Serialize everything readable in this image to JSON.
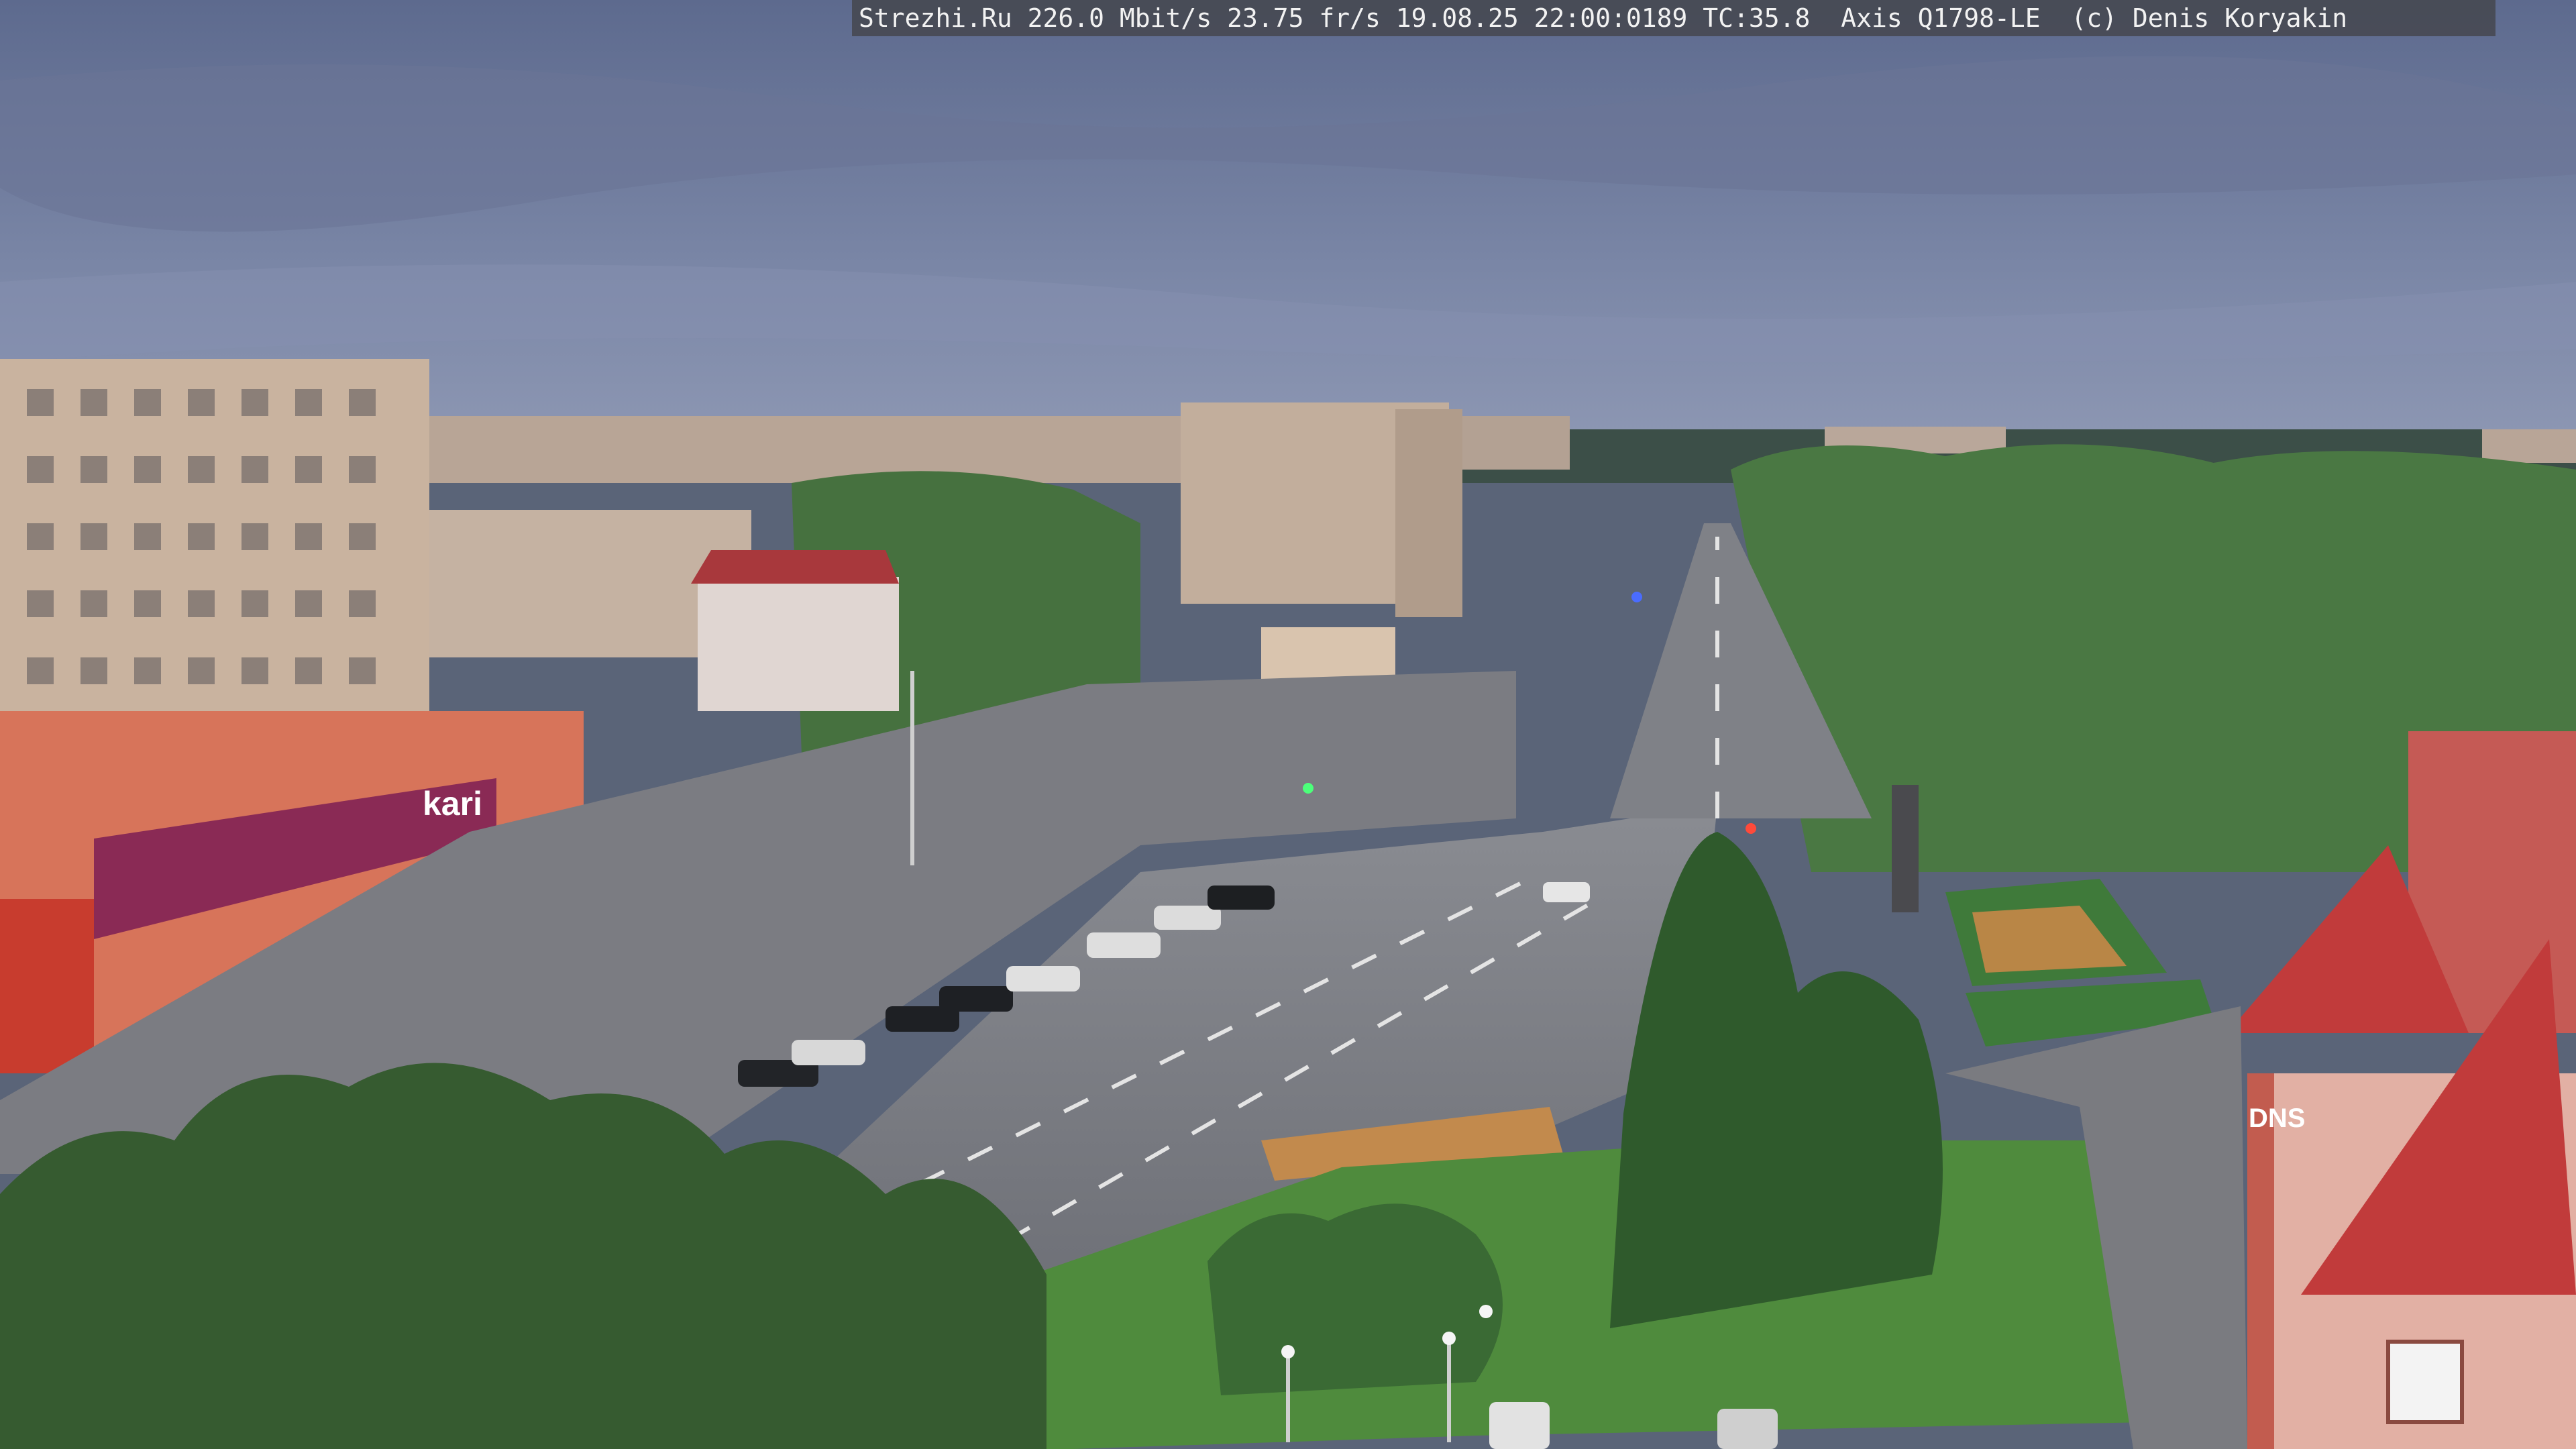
{
  "overlay": {
    "text": "Strezhi.Ru 226.0 Mbit/s 23.75 fr/s 19.08.25 22:00:0189 TC:35.8  Axis Q1798-LE  (c) Denis Koryakin"
  },
  "signs": {
    "kari_store": "kari",
    "dns_store": "DNS"
  },
  "colors": {
    "sky": "#6f7ca0",
    "trees": "#3f6b3a",
    "road": "#7c7f86",
    "kari_sign": "#8a2a55",
    "roof_red": "#c13b3b"
  }
}
